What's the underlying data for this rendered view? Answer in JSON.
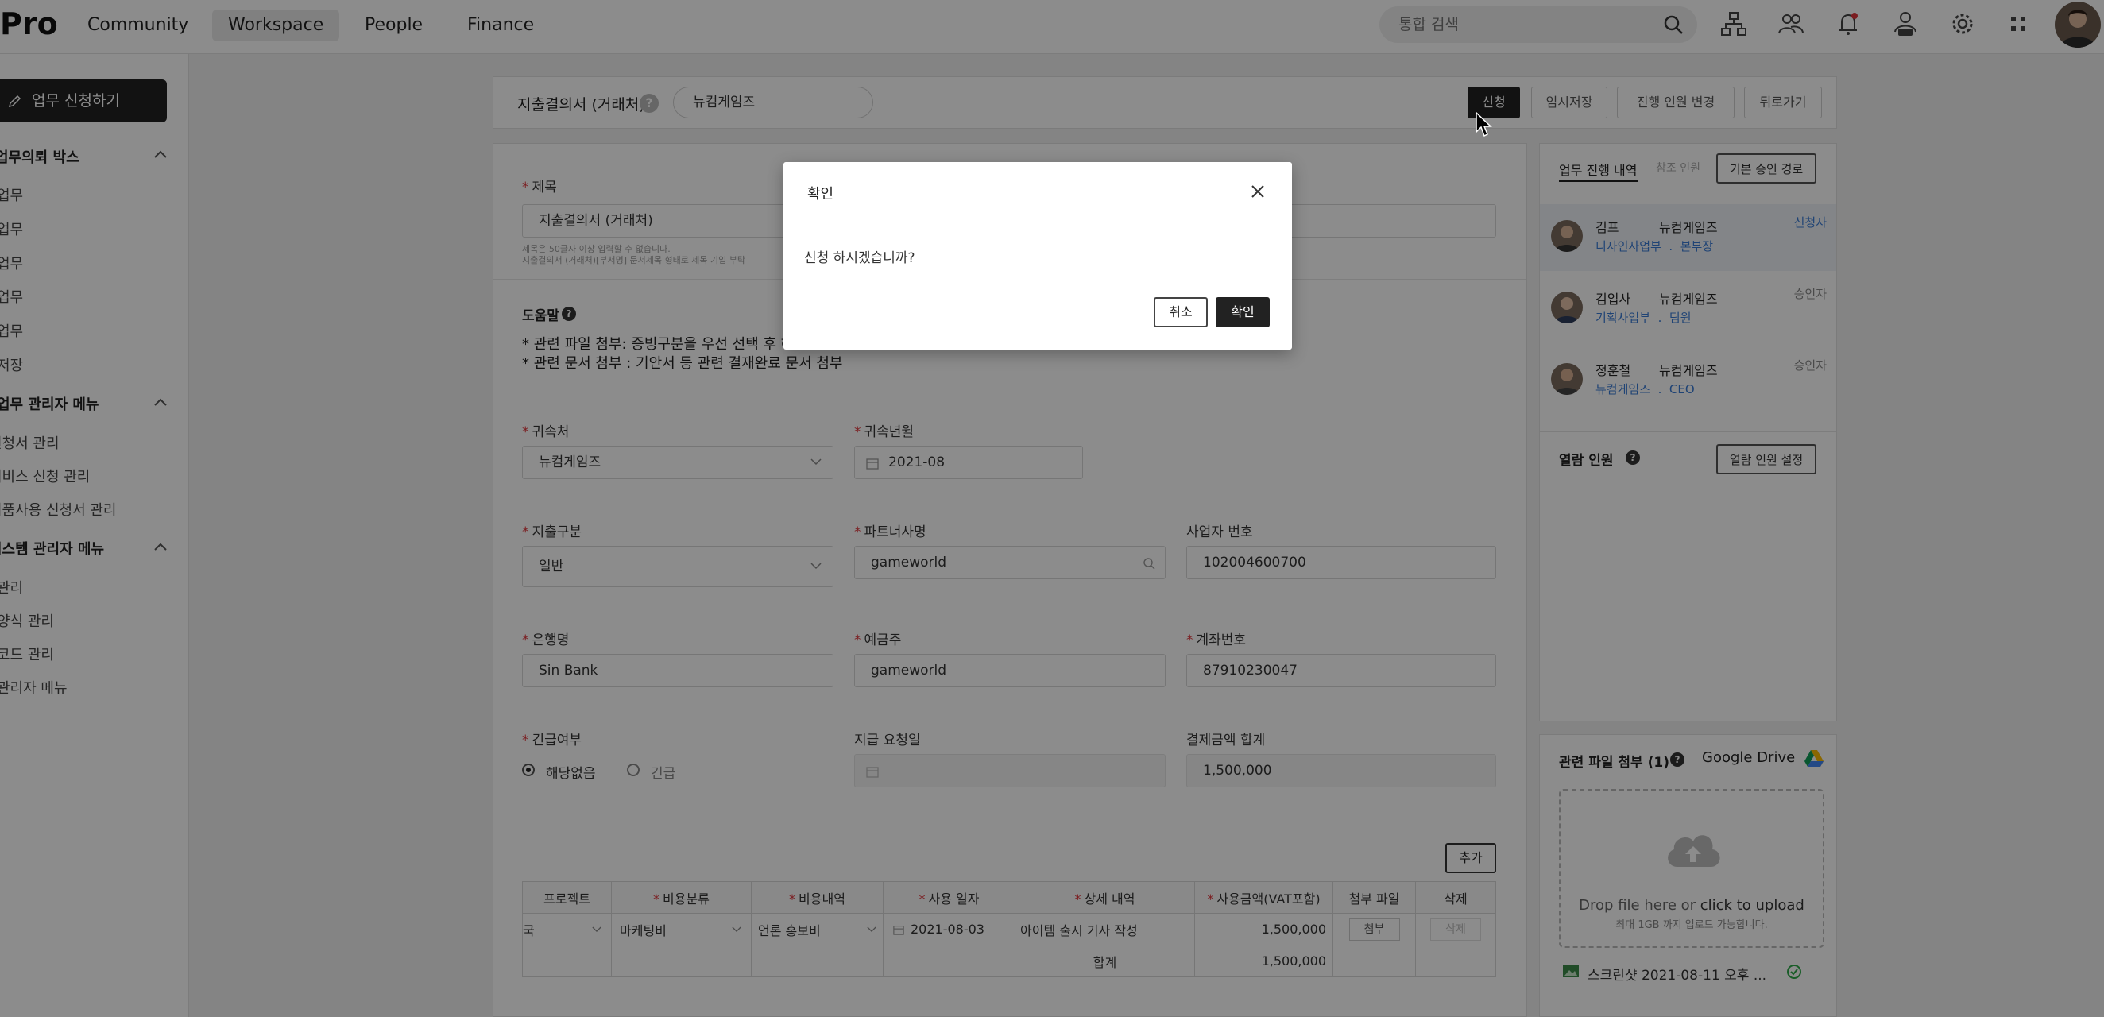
{
  "app": {
    "logo": "Pro"
  },
  "nav": {
    "items": [
      "Community",
      "Workspace",
      "People",
      "Finance"
    ],
    "active": "Workspace"
  },
  "search": {
    "placeholder": "통합 검색"
  },
  "sidebar": {
    "apply_label": "업무 신청하기",
    "sections": [
      {
        "title": "업무의뢰 박스",
        "items": [
          "업무",
          "업무",
          "업무",
          "업무",
          "업무",
          "저장"
        ]
      },
      {
        "title": "업무 관리자 메뉴",
        "items": [
          "신청서 관리",
          "서비스 신청 관리",
          "비품사용 신청서 관리"
        ]
      },
      {
        "title": "시스템 관리자 메뉴",
        "items": [
          "관리",
          "양식 관리",
          "코드 관리",
          "관리자 메뉴"
        ]
      }
    ]
  },
  "header": {
    "doc_type": "지출결의서 (거래처)",
    "help": "?",
    "company": "뉴컴게임즈",
    "buttons": {
      "apply": "신청",
      "temp_save": "임시저장",
      "change_people": "진행 인원 변경",
      "back": "뒤로가기"
    }
  },
  "form": {
    "title": {
      "label": "제목",
      "value": "지출결의서 (거래처)",
      "hints": [
        "제목은 50글자 이상 입력할 수 없습니다.",
        "지출결의서 (거래처)[부서명] 문서제목 형태로 제목 기입 부탁"
      ]
    },
    "help": {
      "title": "도움말",
      "lines": [
        "* 관련 파일 첨부: 증빙구분을 우선 선택 후 해",
        "* 관련 문서 첨부 : 기안서 등 관련 결재완료 문서 첨부"
      ]
    },
    "belong": {
      "label": "귀속처",
      "value": "뉴컴게임즈"
    },
    "belong_month": {
      "label": "귀속년월",
      "value": "2021-08"
    },
    "expense_type": {
      "label": "지출구분",
      "value": "일반"
    },
    "partner": {
      "label": "파트너사명",
      "value": "gameworld"
    },
    "biz_no": {
      "label": "사업자 번호",
      "value": "102004600700"
    },
    "bank": {
      "label": "은행명",
      "value": "Sin Bank"
    },
    "holder": {
      "label": "예금주",
      "value": "gameworld"
    },
    "account": {
      "label": "계좌번호",
      "value": "87910230047"
    },
    "urgent": {
      "label": "긴급여부",
      "options": [
        "해당없음",
        "긴급"
      ],
      "selected": "해당없음"
    },
    "pay_date": {
      "label": "지급 요청일",
      "value": ""
    },
    "total": {
      "label": "결제금액 합계",
      "value": "1,500,000"
    },
    "add_label": "추가",
    "table": {
      "headers": [
        "프로젝트",
        "비용분류",
        "비용내역",
        "사용 일자",
        "상세 내역",
        "사용금액(VAT포함)",
        "첨부 파일",
        "삭제"
      ],
      "row": {
        "project": "국",
        "category": "마케팅비",
        "detail": "언론 홍보비",
        "date": "2021-08-03",
        "desc": "아이템 출시 기사 작성",
        "amount": "1,500,000",
        "attach": "첨부",
        "delete": "삭제"
      },
      "sum_label": "합계",
      "sum_value": "1,500,000"
    }
  },
  "approval": {
    "tabs": [
      "업무 진행 내역",
      "참조 인원"
    ],
    "route_btn": "기본 승인 경로",
    "people": [
      {
        "name": "김프",
        "company": "뉴컴게임즈",
        "dept": "디자인사업부",
        "sep": ".",
        "pos": "본부장",
        "role": "신청자"
      },
      {
        "name": "김입사",
        "company": "뉴컴게임즈",
        "dept": "기획사업부",
        "sep": ".",
        "pos": "팀원",
        "role": "승인자"
      },
      {
        "name": "정훈철",
        "company": "뉴컴게임즈",
        "dept": "뉴컴게임즈",
        "sep": ".",
        "pos": "CEO",
        "role": "승인자"
      }
    ],
    "viewers_title": "열람 인원",
    "viewers_btn": "열람 인원 설정"
  },
  "files": {
    "title": "관련 파일 첨부 (1)",
    "drive": "Google Drive",
    "drop_text": "Drop file here or",
    "drop_link": "click to upload",
    "drop_hint": "최대 1GB 까지 업로드 가능합니다.",
    "file_name": "스크린샷 2021-08-11 오후 ..."
  },
  "modal": {
    "title": "확인",
    "message": "신청 하시겠습니까?",
    "cancel": "취소",
    "ok": "확인"
  },
  "colors": {
    "accent": "#3a7bd5",
    "required": "#e0353b",
    "dark": "#222222"
  }
}
